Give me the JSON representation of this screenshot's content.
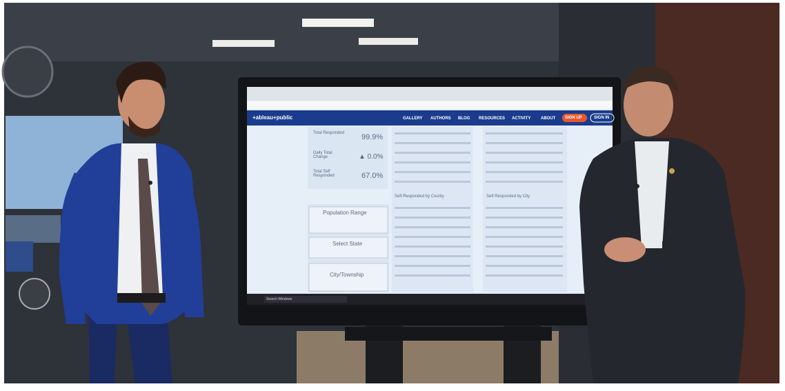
{
  "scene": {
    "description_colors": {
      "wall": "#2b2f35",
      "screen": "#e8f0fa",
      "suit_left": "#1f3b8c",
      "suit_right": "#23262d"
    }
  },
  "screen": {
    "topbar": {
      "logo": "+ableau+public",
      "nav": [
        "GALLERY",
        "AUTHORS",
        "BLOG",
        "RESOURCES",
        "ACTIVITY",
        "ABOUT"
      ],
      "signup": "SIGN UP",
      "signin": "SIGN IN"
    },
    "kpis": [
      {
        "label": "Total Responded",
        "value": "99.9%"
      },
      {
        "label": "Daily Total Change",
        "value": "▲ 0.0%"
      },
      {
        "label": "Total Self Responded",
        "value": "67.0%"
      }
    ],
    "filters": {
      "population_range": "Population Range",
      "select_state": "Select State",
      "city_township": "City/Township"
    },
    "tables": {
      "county_title": "Self-Responded by County",
      "city_title": "Self-Responded by City"
    },
    "taskbar": {
      "search": "Search Windows"
    }
  }
}
